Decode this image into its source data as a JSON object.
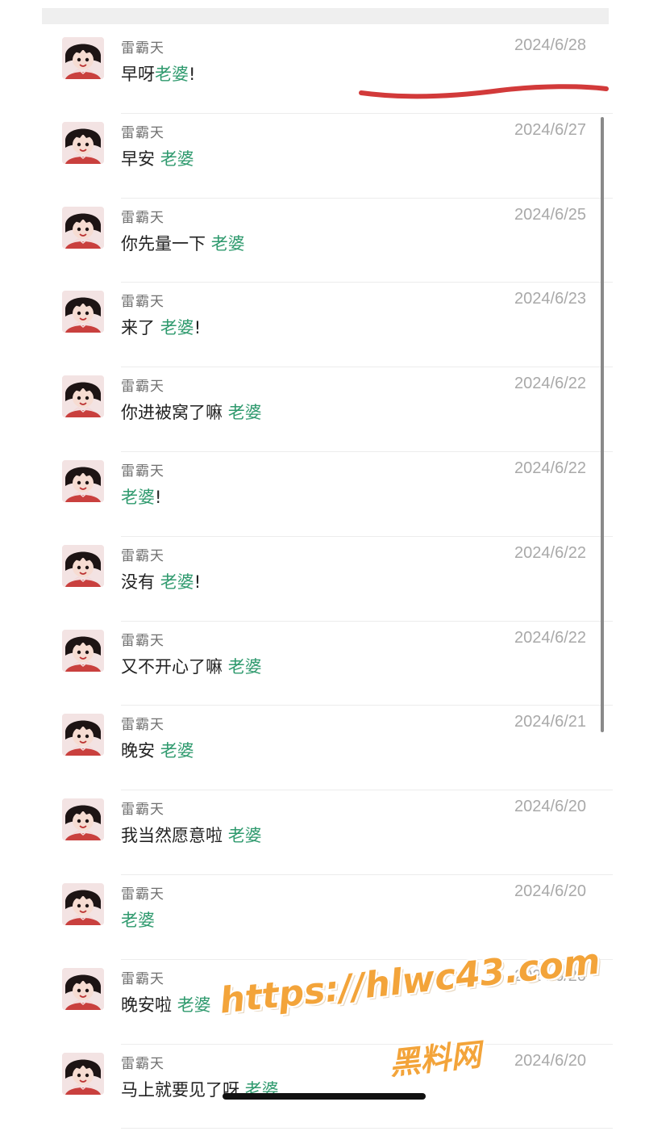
{
  "colors": {
    "highlight": "#2f9a6e",
    "date": "#a9a9a9",
    "name": "#6f6f6f",
    "annotation": "#d23a3a",
    "watermark": "#f3a43a"
  },
  "messages": [
    {
      "sender": "雷霸天",
      "date": "2024/6/28",
      "text": "早呀",
      "highlight": "老婆",
      "suffix": "!"
    },
    {
      "sender": "雷霸天",
      "date": "2024/6/27",
      "text": "早安 ",
      "highlight": "老婆",
      "suffix": ""
    },
    {
      "sender": "雷霸天",
      "date": "2024/6/25",
      "text": "你先量一下 ",
      "highlight": "老婆",
      "suffix": ""
    },
    {
      "sender": "雷霸天",
      "date": "2024/6/23",
      "text": "来了 ",
      "highlight": "老婆",
      "suffix": "!"
    },
    {
      "sender": "雷霸天",
      "date": "2024/6/22",
      "text": "你进被窝了嘛 ",
      "highlight": "老婆",
      "suffix": ""
    },
    {
      "sender": "雷霸天",
      "date": "2024/6/22",
      "text": "",
      "highlight": "老婆",
      "suffix": "!"
    },
    {
      "sender": "雷霸天",
      "date": "2024/6/22",
      "text": "没有 ",
      "highlight": "老婆",
      "suffix": "!"
    },
    {
      "sender": "雷霸天",
      "date": "2024/6/22",
      "text": "又不开心了嘛 ",
      "highlight": "老婆",
      "suffix": ""
    },
    {
      "sender": "雷霸天",
      "date": "2024/6/21",
      "text": "晚安 ",
      "highlight": "老婆",
      "suffix": ""
    },
    {
      "sender": "雷霸天",
      "date": "2024/6/20",
      "text": "我当然愿意啦 ",
      "highlight": "老婆",
      "suffix": ""
    },
    {
      "sender": "雷霸天",
      "date": "2024/6/20",
      "text": "",
      "highlight": "老婆",
      "suffix": ""
    },
    {
      "sender": "雷霸天",
      "date": "2024/6/20",
      "text": "晚安啦 ",
      "highlight": "老婆",
      "suffix": ""
    },
    {
      "sender": "雷霸天",
      "date": "2024/6/20",
      "text": "马上就要见了呀 ",
      "highlight": "老婆",
      "suffix": ""
    }
  ],
  "watermark": {
    "url": "https://hlwc43.com",
    "name": "黑料网"
  }
}
